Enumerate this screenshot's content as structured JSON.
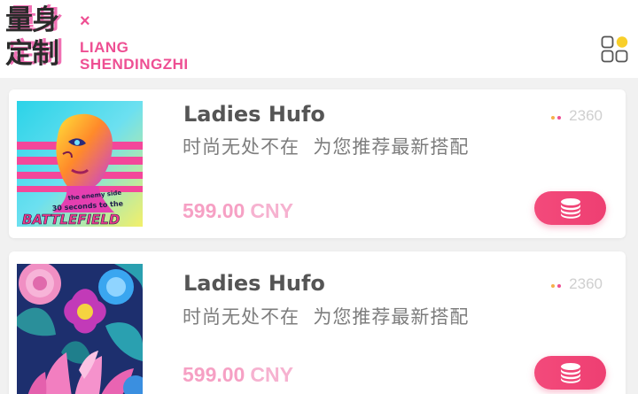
{
  "header": {
    "logo_line1": "量身",
    "logo_line2": "定制",
    "times_mark": "×",
    "brand_line1": "LIANG",
    "brand_line2": "SHENDINGZHI",
    "menu_icon": "grid-menu-icon"
  },
  "colors": {
    "accent": "#ee4f93",
    "button": "#f04577",
    "price": "#f6a0c4",
    "count": "#cfcfcf"
  },
  "products": [
    {
      "title": "Ladies Hufo",
      "subtitle": "时尚无处不在  为您推荐最新搭配",
      "count": "2360",
      "price_value": "599.00",
      "price_currency": "CNY",
      "image": "poster-portrait-image",
      "button_icon": "coin-stack-icon",
      "poster_text": [
        "the enemy side",
        "30 seconds to the",
        "BATTLEFIELD"
      ]
    },
    {
      "title": "Ladies Hufo",
      "subtitle": "时尚无处不在  为您推荐最新搭配",
      "count": "2360",
      "price_value": "599.00",
      "price_currency": "CNY",
      "image": "floral-pattern-image",
      "button_icon": "coin-stack-icon"
    }
  ]
}
